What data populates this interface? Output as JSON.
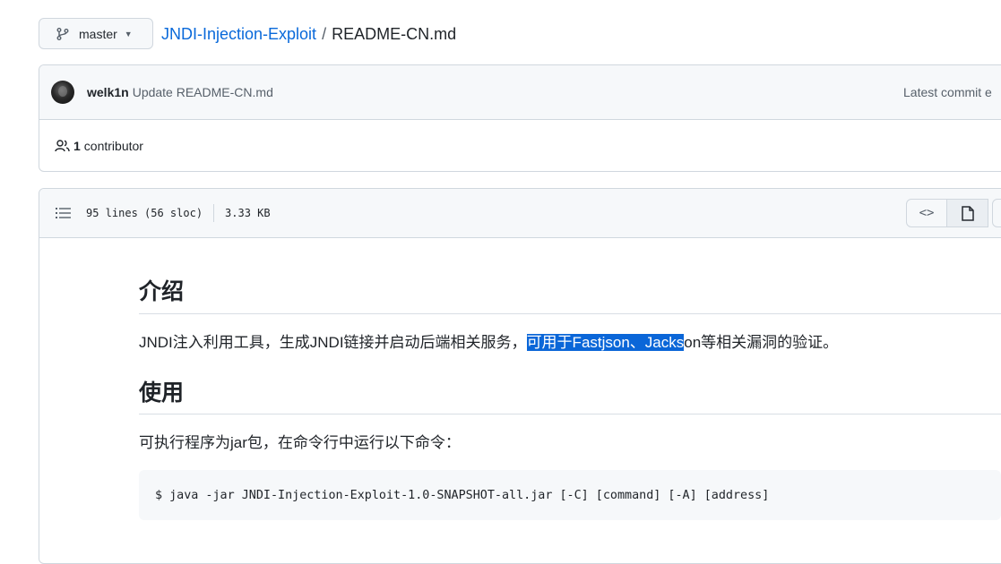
{
  "branch": {
    "label": "master"
  },
  "breadcrumb": {
    "repo": "JNDI-Injection-Exploit",
    "separator": "/",
    "file": "README-CN.md"
  },
  "commit": {
    "author": "welk1n",
    "message": "Update README-CN.md",
    "latest_label": "Latest commit",
    "latest_hash_visible": "e"
  },
  "contributors": {
    "count": "1",
    "label": "contributor"
  },
  "file_info": {
    "lines": "95 lines (56 sloc)",
    "size": "3.33 KB"
  },
  "view_toggle": {
    "code_icon": "<>",
    "preview_icon": "file-icon"
  },
  "readme": {
    "intro_heading": "介绍",
    "intro_before": "JNDI注入利用工具，生成JNDI链接并启动后端相关服务，",
    "intro_selected": "可用于Fastjson、Jacks",
    "intro_after": "on等相关漏洞的验证。",
    "usage_heading": "使用",
    "usage_text": "可执行程序为jar包，在命令行中运行以下命令：",
    "command": "$ java -jar JNDI-Injection-Exploit-1.0-SNAPSHOT-all.jar [-C] [command] [-A] [address]"
  },
  "colors": {
    "link": "#0969da",
    "selection": "#0a66d8",
    "border": "#d0d7de",
    "header_bg": "#f6f8fa"
  }
}
